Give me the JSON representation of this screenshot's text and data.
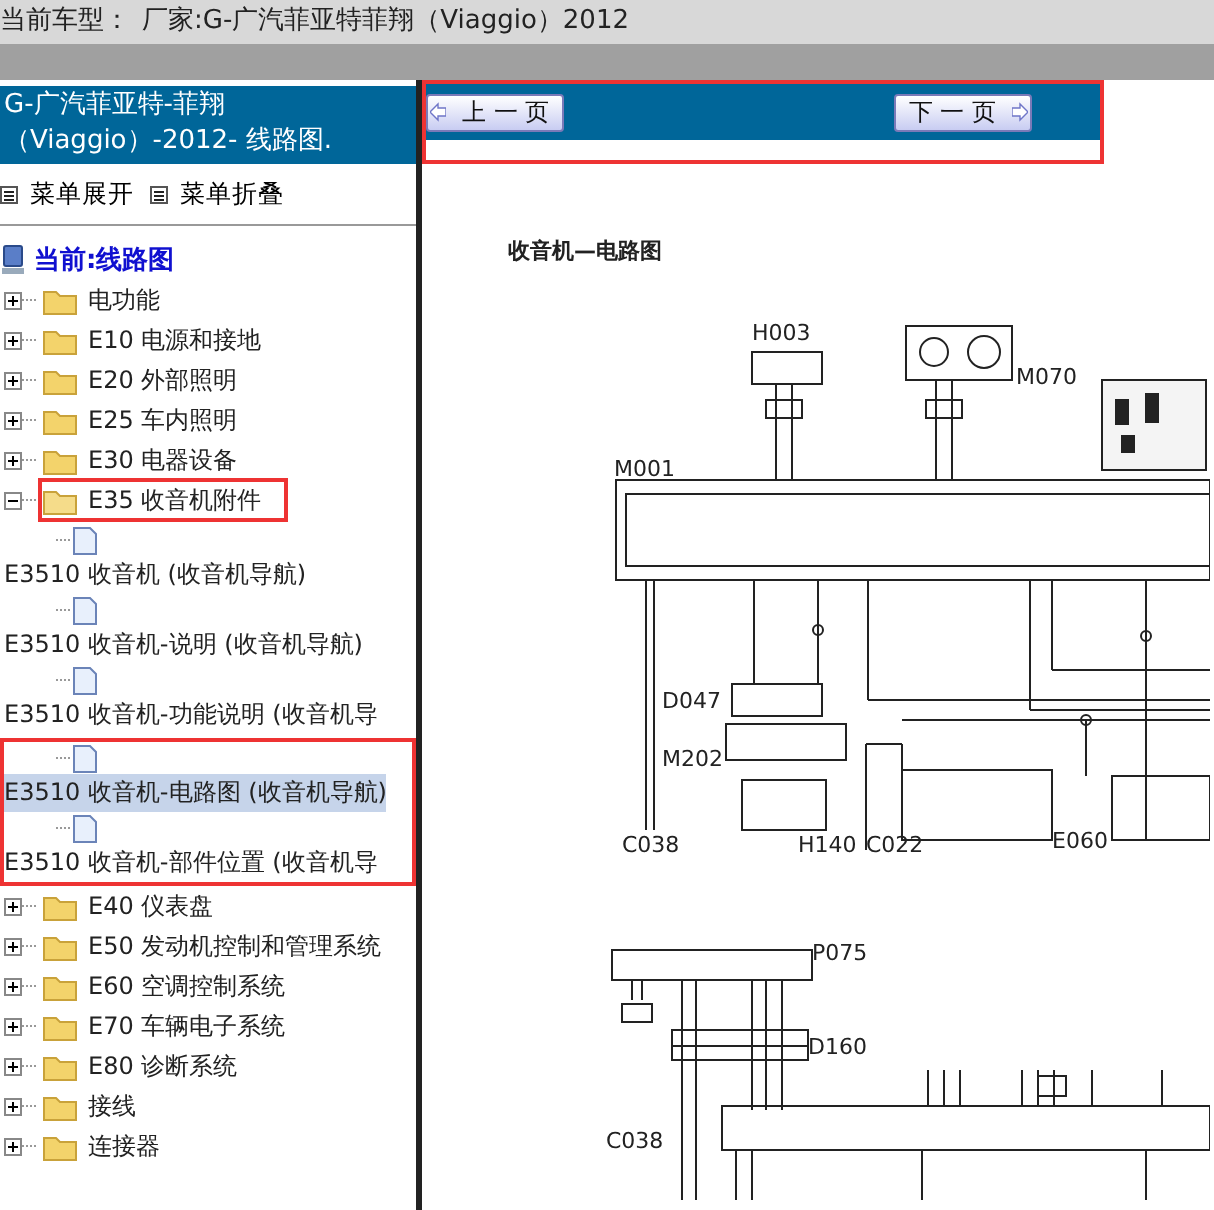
{
  "top_bar": {
    "label": "当前车型：",
    "value": "厂家:G-广汽菲亚特菲翔（Viaggio）2012"
  },
  "sidebar": {
    "header": [
      "G-广汽菲亚特-菲翔",
      "（Viaggio）-2012- 线路图."
    ],
    "menu_actions": [
      "菜单展开",
      "菜单折叠"
    ],
    "root": "当前:线路图",
    "tree": [
      {
        "label": "电功能",
        "expanded": false,
        "highlighted": false
      },
      {
        "label": "E10 电源和接地",
        "expanded": false,
        "highlighted": false
      },
      {
        "label": "E20 外部照明",
        "expanded": false,
        "highlighted": false
      },
      {
        "label": "E25 车内照明",
        "expanded": false,
        "highlighted": false
      },
      {
        "label": "E30 电器设备",
        "expanded": false,
        "highlighted": false
      },
      {
        "label": "E35 收音机附件",
        "expanded": true,
        "highlighted": true,
        "children": [
          {
            "label": "E3510 收音机 (收音机导航)",
            "selected": false,
            "highlighted": false
          },
          {
            "label": "E3510 收音机-说明 (收音机导航)",
            "selected": false,
            "highlighted": false
          },
          {
            "label": "E3510 收音机-功能说明 (收音机导",
            "selected": false,
            "highlighted": false
          },
          {
            "label": "E3510 收音机-电路图 (收音机导航)",
            "selected": true,
            "highlighted": true
          },
          {
            "label": "E3510 收音机-部件位置 (收音机导",
            "selected": false,
            "highlighted": true
          }
        ]
      },
      {
        "label": "E40 仪表盘",
        "expanded": false,
        "highlighted": false
      },
      {
        "label": "E50 发动机控制和管理系统",
        "expanded": false,
        "highlighted": false
      },
      {
        "label": "E60 空调控制系统",
        "expanded": false,
        "highlighted": false
      },
      {
        "label": "E70 车辆电子系统",
        "expanded": false,
        "highlighted": false
      },
      {
        "label": "E80 诊断系统",
        "expanded": false,
        "highlighted": false
      },
      {
        "label": "接线",
        "expanded": false,
        "highlighted": false
      },
      {
        "label": "连接器",
        "expanded": false,
        "highlighted": false
      }
    ]
  },
  "nav_bar": {
    "highlighted": true,
    "prev": "上 一 页",
    "next": "下 一 页"
  },
  "document": {
    "title": "收音机—电路图",
    "labels": [
      "H003",
      "M070",
      "M001",
      "D047",
      "M202",
      "C038",
      "H140",
      "C022",
      "E060",
      "P075",
      "D160",
      "C038"
    ]
  }
}
